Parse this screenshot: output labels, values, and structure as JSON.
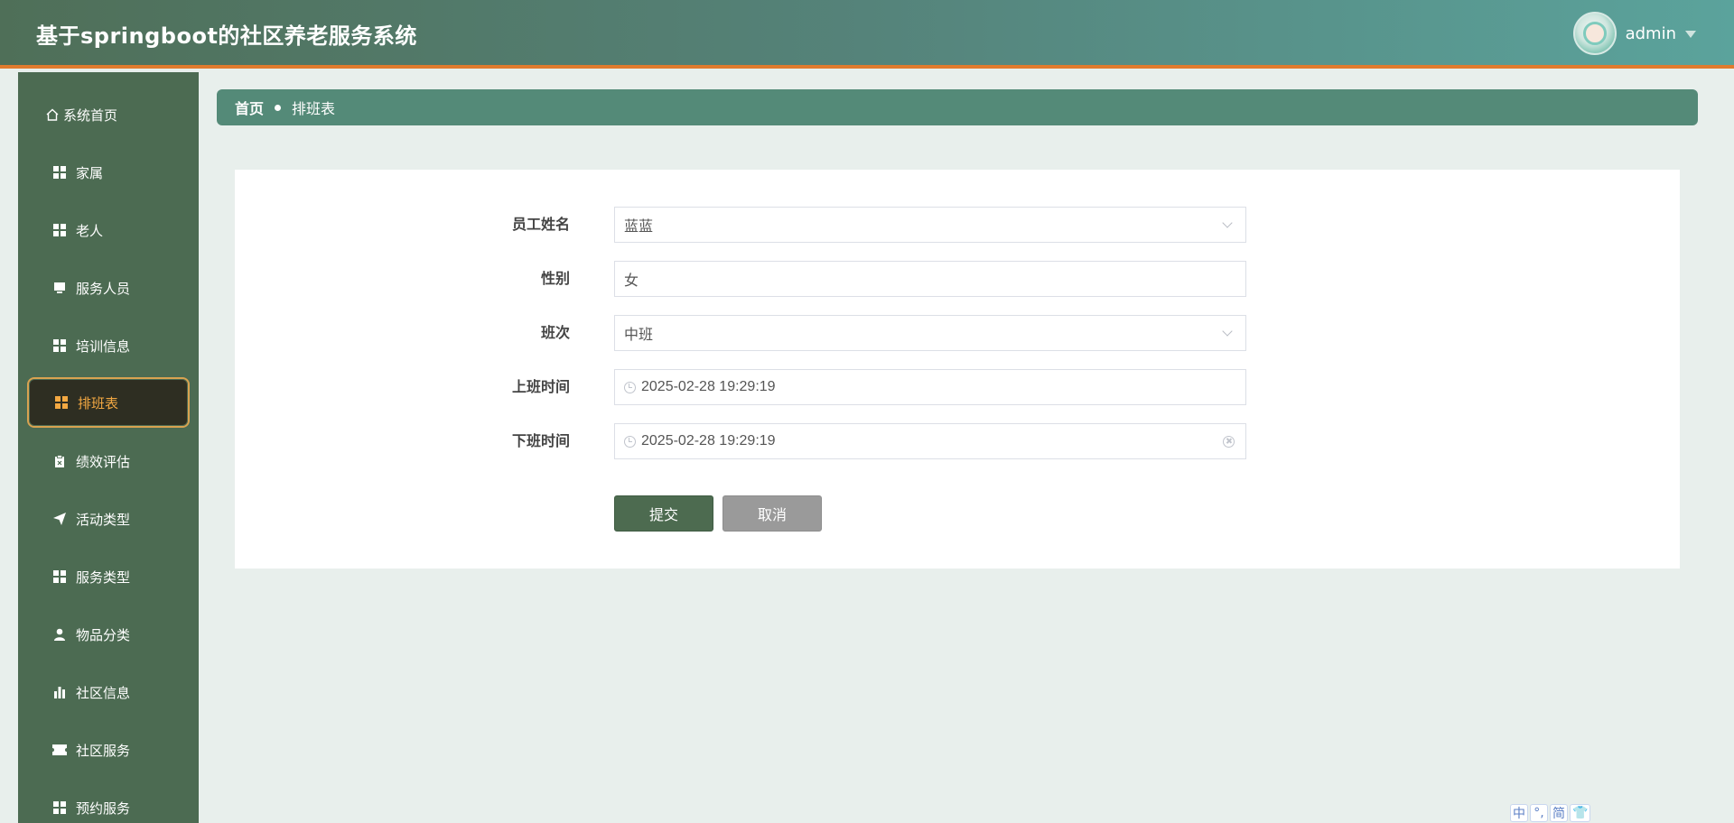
{
  "header": {
    "app_title": "基于springboot的社区养老服务系统",
    "user_name": "admin"
  },
  "sidebar": {
    "items": [
      {
        "label": "系统首页",
        "icon": "home-icon"
      },
      {
        "label": "家属",
        "icon": "grid-icon"
      },
      {
        "label": "老人",
        "icon": "grid-icon"
      },
      {
        "label": "服务人员",
        "icon": "monitor-icon"
      },
      {
        "label": "培训信息",
        "icon": "grid-icon"
      },
      {
        "label": "排班表",
        "icon": "grid-icon",
        "active": true
      },
      {
        "label": "绩效评估",
        "icon": "clipboard-icon"
      },
      {
        "label": "活动类型",
        "icon": "paper-plane-icon"
      },
      {
        "label": "服务类型",
        "icon": "grid-icon"
      },
      {
        "label": "物品分类",
        "icon": "user-icon"
      },
      {
        "label": "社区信息",
        "icon": "bar-chart-icon"
      },
      {
        "label": "社区服务",
        "icon": "ticket-icon"
      },
      {
        "label": "预约服务",
        "icon": "grid-icon"
      }
    ]
  },
  "breadcrumb": {
    "home": "首页",
    "current": "排班表"
  },
  "form": {
    "staff_name": {
      "label": "员工姓名",
      "value": "蓝蓝"
    },
    "gender": {
      "label": "性别",
      "value": "女"
    },
    "shift": {
      "label": "班次",
      "value": "中班"
    },
    "start_time": {
      "label": "上班时间",
      "value": "2025-02-28 19:29:19"
    },
    "end_time": {
      "label": "下班时间",
      "value": "2025-02-28 19:29:19"
    },
    "submit_label": "提交",
    "cancel_label": "取消"
  },
  "ime": {
    "lang": "中",
    "punct": "°,",
    "script": "简",
    "skin": "👕"
  },
  "colors": {
    "header_start": "#4f6f58",
    "header_end": "#5ba39c",
    "accent_orange": "#e07b2e",
    "sidebar_bg": "#4c6b52",
    "active_text": "#f3a842",
    "breadcrumb_bg": "#548a78",
    "submit_bg": "#4d6b50",
    "cancel_bg": "#9a9a9a"
  }
}
